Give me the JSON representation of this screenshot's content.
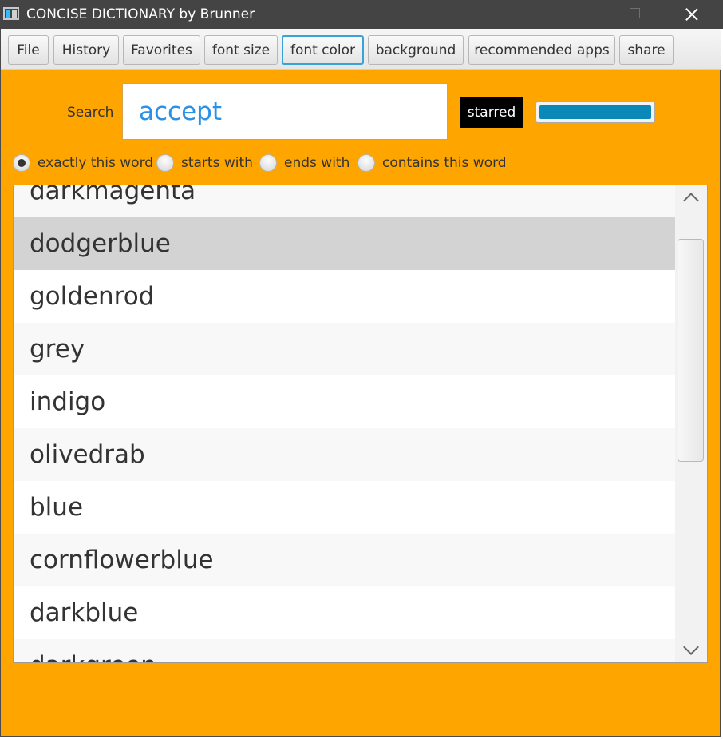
{
  "window": {
    "title": "CONCISE DICTIONARY by Brunner",
    "controls": [
      "minimize-icon",
      "maximize-icon",
      "close-icon"
    ]
  },
  "toolbar": {
    "buttons": [
      {
        "label": "File"
      },
      {
        "label": "History"
      },
      {
        "label": "Favorites"
      },
      {
        "label": "font size"
      },
      {
        "label": "font color",
        "focused": true
      },
      {
        "label": "background"
      },
      {
        "label": "recommended apps"
      },
      {
        "label": "share"
      }
    ]
  },
  "search": {
    "label": "Search",
    "value": "accept",
    "starred_label": "starred",
    "color_value": "#0a88b7"
  },
  "match_modes": {
    "selected": "exactly this word",
    "options": [
      {
        "label": "exactly this word",
        "checked": true
      },
      {
        "label": "starts with",
        "checked": false
      },
      {
        "label": "ends with",
        "checked": false
      },
      {
        "label": "contains this word",
        "checked": false
      }
    ]
  },
  "word_list": {
    "items": [
      "darkmagenta",
      "dodgerblue",
      "goldenrod",
      "grey",
      "indigo",
      "olivedrab",
      "blue",
      "cornflowerblue",
      "darkblue",
      "darkgreen"
    ],
    "selected": "dodgerblue"
  },
  "colors": {
    "background": "#FFA500",
    "search_text": "#2a91e6",
    "selected_row": "#d3d3d3",
    "focus_ring": "#3aa3d6"
  }
}
